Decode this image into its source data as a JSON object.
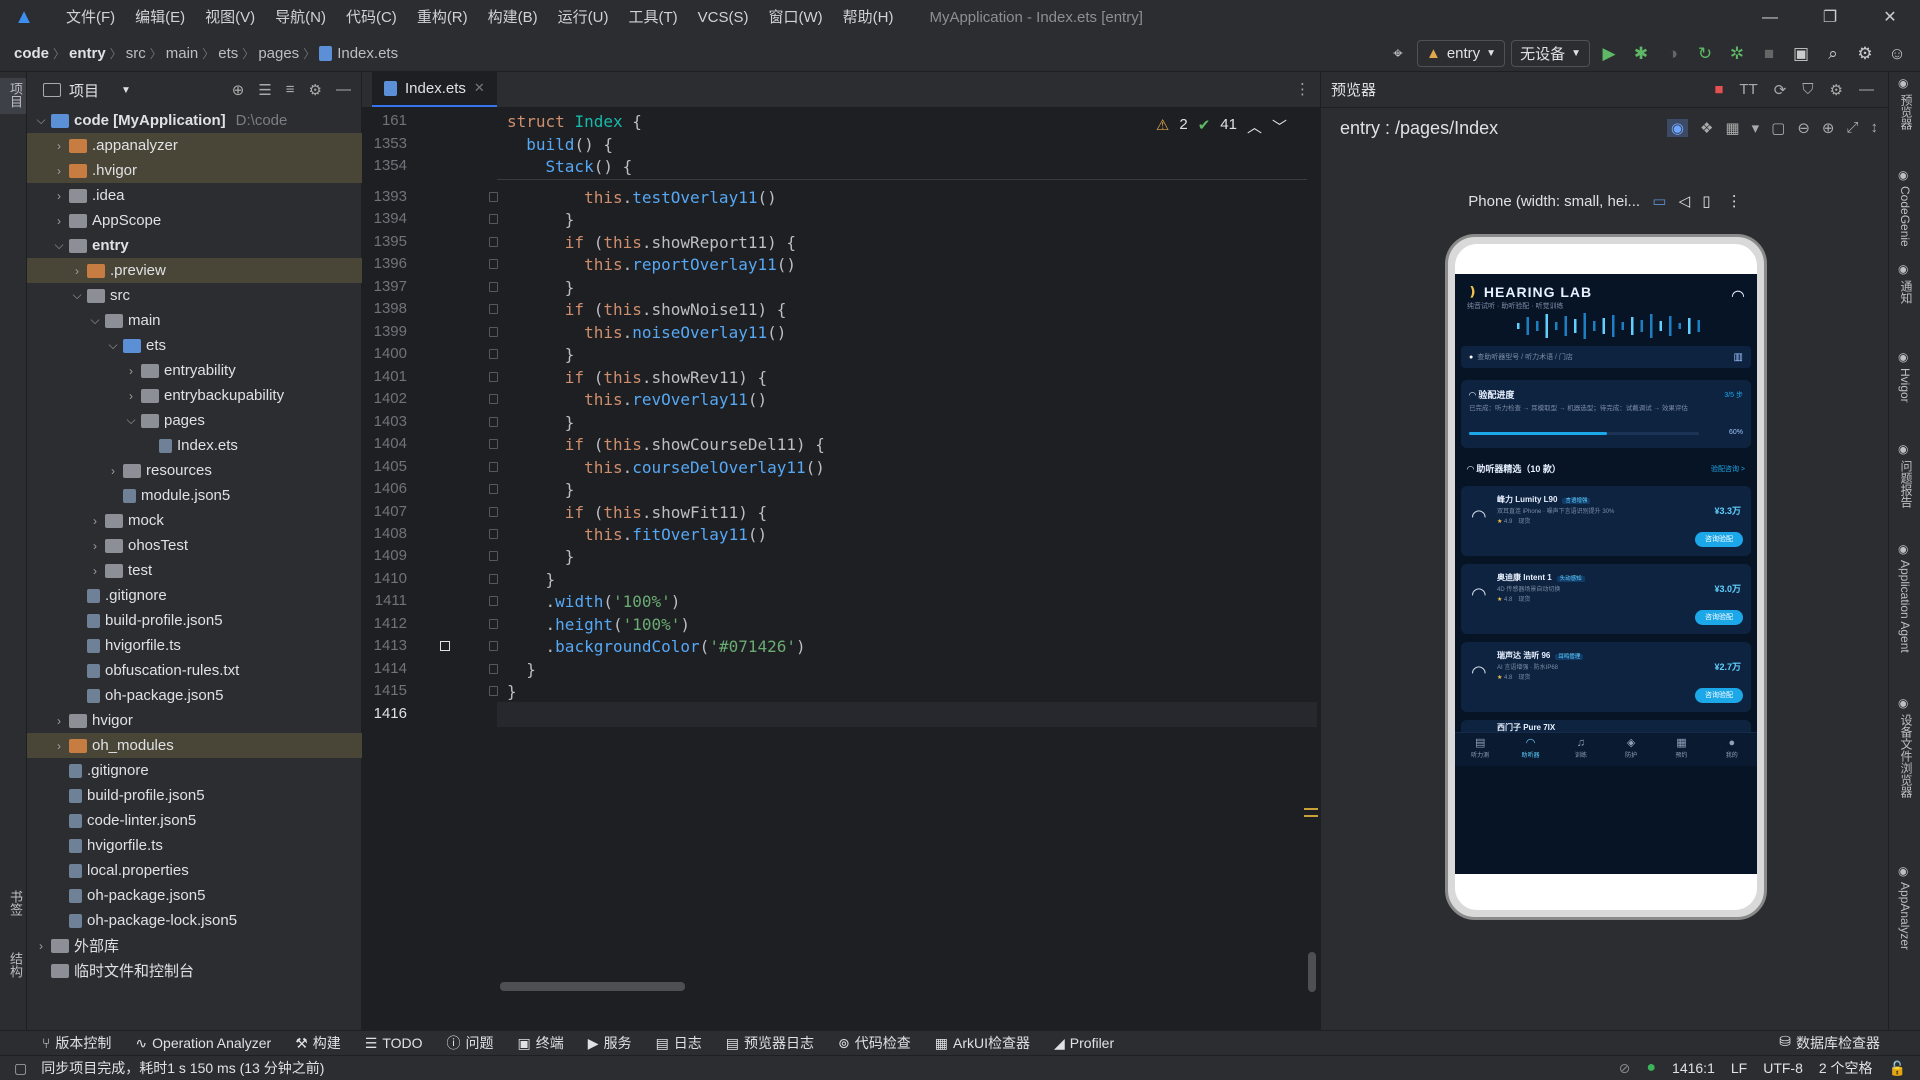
{
  "menu": {
    "items": [
      "文件(F)",
      "编辑(E)",
      "视图(V)",
      "导航(N)",
      "代码(C)",
      "重构(R)",
      "构建(B)",
      "运行(U)",
      "工具(T)",
      "VCS(S)",
      "窗口(W)",
      "帮助(H)"
    ],
    "window_title": "MyApplication - Index.ets [entry]"
  },
  "breadcrumb": [
    "code",
    "entry",
    "src",
    "main",
    "ets",
    "pages",
    "Index.ets"
  ],
  "toolbar": {
    "config": "entry",
    "device": "无设备"
  },
  "left_strip": {
    "project_label": "项目",
    "bookmarks_label": "书签",
    "structure_label": "结构"
  },
  "project_panel": {
    "title": "项目",
    "tree": [
      {
        "label": "code [MyApplication]",
        "hint": "D:\\code",
        "depth": 0,
        "expanded": true,
        "type": "folder-blue",
        "hl": false,
        "bold": true
      },
      {
        "label": ".appanalyzer",
        "depth": 1,
        "expanded": false,
        "type": "folder-orange",
        "hl": true
      },
      {
        "label": ".hvigor",
        "depth": 1,
        "expanded": false,
        "type": "folder-orange",
        "hl": true
      },
      {
        "label": ".idea",
        "depth": 1,
        "expanded": false,
        "type": "folder",
        "hl": false
      },
      {
        "label": "AppScope",
        "depth": 1,
        "expanded": false,
        "type": "folder",
        "hl": false
      },
      {
        "label": "entry",
        "depth": 1,
        "expanded": true,
        "type": "folder",
        "hl": false,
        "bold": true
      },
      {
        "label": ".preview",
        "depth": 2,
        "expanded": false,
        "type": "folder-orange",
        "hl": true
      },
      {
        "label": "src",
        "depth": 2,
        "expanded": true,
        "type": "folder",
        "hl": false
      },
      {
        "label": "main",
        "depth": 3,
        "expanded": true,
        "type": "folder",
        "hl": false
      },
      {
        "label": "ets",
        "depth": 4,
        "expanded": true,
        "type": "folder-blue",
        "hl": false
      },
      {
        "label": "entryability",
        "depth": 5,
        "expanded": false,
        "type": "folder",
        "hl": false
      },
      {
        "label": "entrybackupability",
        "depth": 5,
        "expanded": false,
        "type": "folder",
        "hl": false
      },
      {
        "label": "pages",
        "depth": 5,
        "expanded": true,
        "type": "folder",
        "hl": false
      },
      {
        "label": "Index.ets",
        "depth": 6,
        "type": "file",
        "hl": false
      },
      {
        "label": "resources",
        "depth": 4,
        "expanded": false,
        "type": "folder",
        "hl": false
      },
      {
        "label": "module.json5",
        "depth": 4,
        "type": "file",
        "hl": false
      },
      {
        "label": "mock",
        "depth": 3,
        "expanded": false,
        "type": "folder",
        "hl": false
      },
      {
        "label": "ohosTest",
        "depth": 3,
        "expanded": false,
        "type": "folder",
        "hl": false
      },
      {
        "label": "test",
        "depth": 3,
        "expanded": false,
        "type": "folder",
        "hl": false
      },
      {
        "label": ".gitignore",
        "depth": 2,
        "type": "file",
        "hl": false
      },
      {
        "label": "build-profile.json5",
        "depth": 2,
        "type": "file",
        "hl": false
      },
      {
        "label": "hvigorfile.ts",
        "depth": 2,
        "type": "file",
        "hl": false
      },
      {
        "label": "obfuscation-rules.txt",
        "depth": 2,
        "type": "file",
        "hl": false
      },
      {
        "label": "oh-package.json5",
        "depth": 2,
        "type": "file",
        "hl": false
      },
      {
        "label": "hvigor",
        "depth": 1,
        "expanded": false,
        "type": "folder",
        "hl": false
      },
      {
        "label": "oh_modules",
        "depth": 1,
        "expanded": false,
        "type": "folder-orange",
        "hl": true
      },
      {
        "label": ".gitignore",
        "depth": 1,
        "type": "file",
        "hl": false
      },
      {
        "label": "build-profile.json5",
        "depth": 1,
        "type": "file",
        "hl": false
      },
      {
        "label": "code-linter.json5",
        "depth": 1,
        "type": "file",
        "hl": false
      },
      {
        "label": "hvigorfile.ts",
        "depth": 1,
        "type": "file",
        "hl": false
      },
      {
        "label": "local.properties",
        "depth": 1,
        "type": "file",
        "hl": false
      },
      {
        "label": "oh-package.json5",
        "depth": 1,
        "type": "file",
        "hl": false
      },
      {
        "label": "oh-package-lock.json5",
        "depth": 1,
        "type": "file",
        "hl": false
      },
      {
        "label": "外部库",
        "depth": 0,
        "expanded": false,
        "type": "lib",
        "hl": false
      },
      {
        "label": "临时文件和控制台",
        "depth": 0,
        "type": "scratch",
        "hl": false
      }
    ]
  },
  "editor": {
    "tab": "Index.ets",
    "warnings": "2",
    "checks": "41",
    "sticky": [
      {
        "ln": "161",
        "code": [
          [
            "kw",
            "struct "
          ],
          [
            "ty",
            "Index "
          ],
          [
            "p",
            "{"
          ]
        ]
      },
      {
        "ln": "1353",
        "code": [
          [
            "p",
            "  "
          ],
          [
            "fn",
            "build"
          ],
          [
            "p",
            "() {"
          ]
        ]
      },
      {
        "ln": "1354",
        "code": [
          [
            "p",
            "    "
          ],
          [
            "fn",
            "Stack"
          ],
          [
            "p",
            "() {"
          ]
        ]
      }
    ],
    "lines": [
      {
        "ln": "1393",
        "code": [
          [
            "p",
            "        "
          ],
          [
            "kw",
            "this"
          ],
          [
            "p",
            "."
          ],
          [
            "fn",
            "testOverlay11"
          ],
          [
            "p",
            "()"
          ]
        ]
      },
      {
        "ln": "1394",
        "code": [
          [
            "p",
            "      }"
          ]
        ]
      },
      {
        "ln": "1395",
        "code": [
          [
            "p",
            "      "
          ],
          [
            "kw",
            "if "
          ],
          [
            "p",
            "("
          ],
          [
            "kw",
            "this"
          ],
          [
            "p",
            ".showReport11) {"
          ]
        ]
      },
      {
        "ln": "1396",
        "code": [
          [
            "p",
            "        "
          ],
          [
            "kw",
            "this"
          ],
          [
            "p",
            "."
          ],
          [
            "fn",
            "reportOverlay11"
          ],
          [
            "p",
            "()"
          ]
        ]
      },
      {
        "ln": "1397",
        "code": [
          [
            "p",
            "      }"
          ]
        ]
      },
      {
        "ln": "1398",
        "code": [
          [
            "p",
            "      "
          ],
          [
            "kw",
            "if "
          ],
          [
            "p",
            "("
          ],
          [
            "kw",
            "this"
          ],
          [
            "p",
            ".showNoise11) {"
          ]
        ]
      },
      {
        "ln": "1399",
        "code": [
          [
            "p",
            "        "
          ],
          [
            "kw",
            "this"
          ],
          [
            "p",
            "."
          ],
          [
            "fn",
            "noiseOverlay11"
          ],
          [
            "p",
            "()"
          ]
        ]
      },
      {
        "ln": "1400",
        "code": [
          [
            "p",
            "      }"
          ]
        ]
      },
      {
        "ln": "1401",
        "code": [
          [
            "p",
            "      "
          ],
          [
            "kw",
            "if "
          ],
          [
            "p",
            "("
          ],
          [
            "kw",
            "this"
          ],
          [
            "p",
            ".showRev11) {"
          ]
        ]
      },
      {
        "ln": "1402",
        "code": [
          [
            "p",
            "        "
          ],
          [
            "kw",
            "this"
          ],
          [
            "p",
            "."
          ],
          [
            "fn",
            "revOverlay11"
          ],
          [
            "p",
            "()"
          ]
        ]
      },
      {
        "ln": "1403",
        "code": [
          [
            "p",
            "      }"
          ]
        ]
      },
      {
        "ln": "1404",
        "code": [
          [
            "p",
            "      "
          ],
          [
            "kw",
            "if "
          ],
          [
            "p",
            "("
          ],
          [
            "kw",
            "this"
          ],
          [
            "p",
            ".showCourseDel11) {"
          ]
        ]
      },
      {
        "ln": "1405",
        "code": [
          [
            "p",
            "        "
          ],
          [
            "kw",
            "this"
          ],
          [
            "p",
            "."
          ],
          [
            "fn",
            "courseDelOverlay11"
          ],
          [
            "p",
            "()"
          ]
        ]
      },
      {
        "ln": "1406",
        "code": [
          [
            "p",
            "      }"
          ]
        ]
      },
      {
        "ln": "1407",
        "code": [
          [
            "p",
            "      "
          ],
          [
            "kw",
            "if "
          ],
          [
            "p",
            "("
          ],
          [
            "kw",
            "this"
          ],
          [
            "p",
            ".showFit11) {"
          ]
        ]
      },
      {
        "ln": "1408",
        "code": [
          [
            "p",
            "        "
          ],
          [
            "kw",
            "this"
          ],
          [
            "p",
            "."
          ],
          [
            "fn",
            "fitOverlay11"
          ],
          [
            "p",
            "()"
          ]
        ]
      },
      {
        "ln": "1409",
        "code": [
          [
            "p",
            "      }"
          ]
        ]
      },
      {
        "ln": "1410",
        "code": [
          [
            "p",
            "    }"
          ]
        ]
      },
      {
        "ln": "1411",
        "code": [
          [
            "p",
            "    ."
          ],
          [
            "fn",
            "width"
          ],
          [
            "p",
            "("
          ],
          [
            "str",
            "'100%'"
          ],
          [
            "p",
            ")"
          ]
        ]
      },
      {
        "ln": "1412",
        "code": [
          [
            "p",
            "    ."
          ],
          [
            "fn",
            "height"
          ],
          [
            "p",
            "("
          ],
          [
            "str",
            "'100%'"
          ],
          [
            "p",
            ")"
          ]
        ]
      },
      {
        "ln": "1413",
        "code": [
          [
            "p",
            "    ."
          ],
          [
            "fn",
            "backgroundColor"
          ],
          [
            "p",
            "("
          ],
          [
            "str",
            "'#071426'"
          ],
          [
            "p",
            ")"
          ]
        ]
      },
      {
        "ln": "1414",
        "code": [
          [
            "p",
            "  }"
          ]
        ]
      },
      {
        "ln": "1415",
        "code": [
          [
            "p",
            "}"
          ]
        ]
      },
      {
        "ln": "1416",
        "code": [
          [
            "p",
            ""
          ]
        ]
      }
    ]
  },
  "preview": {
    "title": "预览器",
    "path": "entry : /pages/Index",
    "device": "Phone (width: small, hei...",
    "app": {
      "brand": "HEARING LAB",
      "subtitle": "纯音试听 · 助听验配 · 听觉训练",
      "search": "查助听器型号 / 听力术语 / 门店",
      "progress_title": "验配进度",
      "progress_step": "3/5 步",
      "progress_desc": "已完成：听力检查 → 耳模取型 → 机器选型；待完成：试戴调试 → 效果评估",
      "progress_pct": "60%",
      "progress_value": 0.6,
      "list_title": "助听器精选（10 款）",
      "list_link": "验配咨询 >",
      "cards": [
        {
          "name": "峰力 Lumity L90",
          "tag": "言语增强",
          "desc": "双耳直连 iPhone · 噪声下言语识别提升 30%",
          "rating": "4.9",
          "extra": "现货",
          "price": "¥3.3万",
          "btn": "咨询验配"
        },
        {
          "name": "奥迪康 Intent 1",
          "tag": "头动感知",
          "desc": "4D 传感器场景自动切换",
          "rating": "4.8",
          "extra": "现货",
          "price": "¥3.0万",
          "btn": "咨询验配"
        },
        {
          "name": "瑞声达 浩听 96",
          "tag": "耳鸣管理",
          "desc": "AI 言语增强 · 防水IP68",
          "rating": "4.8",
          "extra": "现货",
          "price": "¥2.7万",
          "btn": "咨询验配"
        }
      ],
      "partial_card": "西门子 Pure 7IX",
      "tabs": [
        "听力测",
        "助听器",
        "训练",
        "防护",
        "预约",
        "我的"
      ]
    }
  },
  "right_strip": [
    "预览器",
    "CodeGenie",
    "通知",
    "Hvigor",
    "问题报告",
    "Application Agent",
    "设备文件浏览器",
    "AppAnalyzer"
  ],
  "bottom_tools": [
    "版本控制",
    "Operation Analyzer",
    "构建",
    "TODO",
    "问题",
    "终端",
    "服务",
    "日志",
    "预览器日志",
    "代码检查",
    "ArkUI检查器",
    "Profiler"
  ],
  "bottom_right": "数据库检查器",
  "status": {
    "message": "同步项目完成，耗时1 s 150 ms (13 分钟之前)",
    "position": "1416:1",
    "line_sep": "LF",
    "encoding": "UTF-8",
    "indent": "2 个空格"
  },
  "colors": {
    "accent": "#3574f0",
    "app_bg": "#071426",
    "app_accent": "#1ca7e8"
  }
}
